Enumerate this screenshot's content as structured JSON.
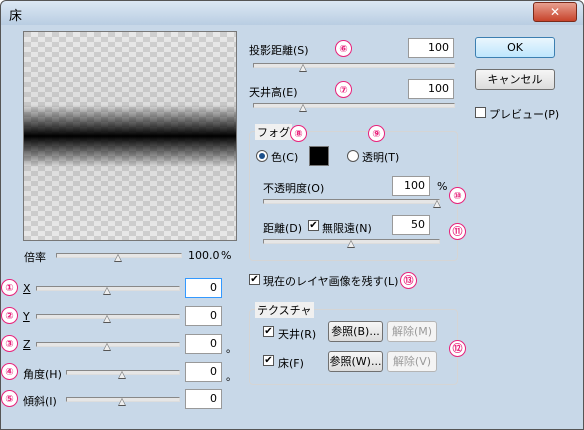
{
  "window": {
    "title": "床",
    "close": "✕"
  },
  "preview": {
    "zoom_label": "倍率",
    "zoom_value": "100.0",
    "zoom_unit": "%",
    "zoom_level": 0.5
  },
  "params": {
    "x": {
      "label": "X",
      "value": "0",
      "badge": "①",
      "level": 0.5
    },
    "y": {
      "label": "Y",
      "value": "0",
      "badge": "②",
      "level": 0.5
    },
    "z": {
      "label": "Z",
      "value": "0",
      "unit": "。",
      "badge": "③",
      "level": 0.5
    },
    "angle": {
      "label": "角度(H)",
      "value": "0",
      "unit": "。",
      "badge": "④",
      "level": 0.5
    },
    "tilt": {
      "label": "傾斜(I)",
      "value": "0",
      "badge": "⑤",
      "level": 0.5
    }
  },
  "projection": {
    "label": "投影距離(S)",
    "value": "100",
    "badge": "⑥",
    "level": 0.25
  },
  "ceiling": {
    "label": "天井高(E)",
    "value": "100",
    "badge": "⑦",
    "level": 0.25
  },
  "fog": {
    "group_label": "フォグ",
    "badge_color": "⑧",
    "badge_transparent": "⑨",
    "color_label": "色(C)",
    "transparent_label": "透明(T)",
    "color_value": "#000000",
    "opacity_label": "不透明度(O)",
    "opacity_value": "100",
    "opacity_unit": "%",
    "opacity_badge": "⑩",
    "opacity_level": 1.0,
    "distance_label": "距離(D)",
    "infinite_label": "無限遠(N)",
    "distance_value": "50",
    "distance_badge": "⑪",
    "distance_level": 0.5
  },
  "keep_image": {
    "label": "現在のレイヤ画像を残す(L)",
    "badge": "⑬"
  },
  "texture": {
    "group_label": "テクスチャ",
    "badge": "⑫",
    "ceiling_label": "天井(R)",
    "floor_label": "床(F)",
    "browse_b": "参照(B)...",
    "release_m": "解除(M)",
    "browse_w": "参照(W)...",
    "release_v": "解除(V)"
  },
  "buttons": {
    "ok": "OK",
    "cancel": "キャンセル",
    "preview": "プレビュー(P)"
  },
  "colors": {
    "badge": "#e8217a"
  }
}
